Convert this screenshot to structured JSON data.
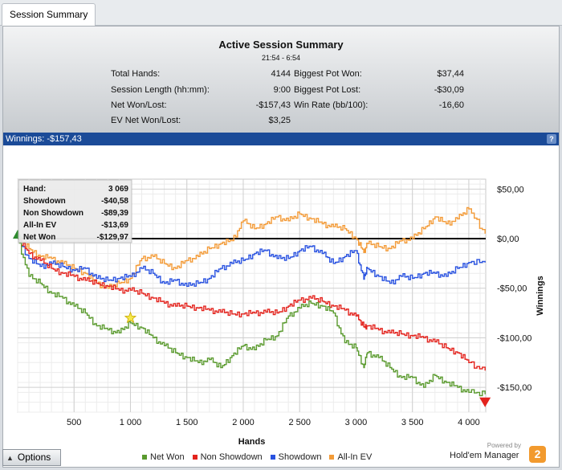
{
  "tab": {
    "label": "Session Summary"
  },
  "summary": {
    "title": "Active Session Summary",
    "time": "21:54 - 6:54",
    "left": [
      {
        "label": "Total Hands:",
        "value": "4144"
      },
      {
        "label": "Session Length (hh:mm):",
        "value": "9:00"
      },
      {
        "label": "Net Won/Lost:",
        "value": "-$157,43"
      },
      {
        "label": "EV Net Won/Lost:",
        "value": "$3,25"
      }
    ],
    "right": [
      {
        "label": "Biggest Pot Won:",
        "value": "$37,44"
      },
      {
        "label": "Biggest Pot Lost:",
        "value": "-$30,09"
      },
      {
        "label": "Win Rate (bb/100):",
        "value": "-16,60"
      }
    ]
  },
  "winnings_bar": {
    "label": "Winnings: -$157,43",
    "help": "?"
  },
  "tooltip": {
    "rows": [
      {
        "label": "Hand:",
        "value": "3 069"
      },
      {
        "label": "Showdown",
        "value": "-$40,58"
      },
      {
        "label": "Non Showdown",
        "value": "-$89,39"
      },
      {
        "label": "All-In EV",
        "value": "-$13,69"
      },
      {
        "label": "Net Won",
        "value": "-$129,97"
      }
    ]
  },
  "chart_data": {
    "type": "line",
    "xlabel": "Hands",
    "ylabel": "Winnings",
    "xlim": [
      0,
      4150
    ],
    "ylim": [
      -175,
      60
    ],
    "x_ticks": [
      500,
      1000,
      1500,
      2000,
      2500,
      3000,
      3500,
      4000
    ],
    "x_tick_labels": [
      "500",
      "1 000",
      "1 500",
      "2 000",
      "2 500",
      "3 000",
      "3 500",
      "4 000"
    ],
    "y_ticks": [
      50,
      0,
      -50,
      -100,
      -150
    ],
    "y_tick_labels": [
      "$50,00",
      "$0,00",
      "-$50,00",
      "-$100,00",
      "-$150,00"
    ],
    "grid": true,
    "legend_position": "bottom",
    "series": [
      {
        "name": "Net Won",
        "color": "#5a9a2e",
        "x": [
          0,
          100,
          200,
          300,
          400,
          500,
          600,
          700,
          800,
          900,
          1000,
          1100,
          1200,
          1300,
          1400,
          1500,
          1600,
          1700,
          1800,
          1900,
          2000,
          2100,
          2200,
          2300,
          2400,
          2500,
          2600,
          2700,
          2800,
          2900,
          3000,
          3069,
          3100,
          3200,
          3300,
          3400,
          3500,
          3600,
          3700,
          3800,
          3900,
          4000,
          4144
        ],
        "y": [
          0,
          -38,
          -45,
          -55,
          -60,
          -68,
          -75,
          -88,
          -92,
          -95,
          -85,
          -90,
          -100,
          -108,
          -115,
          -120,
          -125,
          -122,
          -130,
          -118,
          -108,
          -112,
          -102,
          -98,
          -78,
          -70,
          -65,
          -68,
          -75,
          -105,
          -110,
          -130,
          -115,
          -120,
          -130,
          -140,
          -140,
          -150,
          -138,
          -145,
          -150,
          -155,
          -157
        ]
      },
      {
        "name": "Non Showdown",
        "color": "#e3231d",
        "x": [
          0,
          100,
          200,
          300,
          400,
          500,
          600,
          700,
          800,
          900,
          1000,
          1100,
          1200,
          1300,
          1400,
          1500,
          1600,
          1700,
          1800,
          1900,
          2000,
          2100,
          2200,
          2300,
          2400,
          2500,
          2600,
          2700,
          2800,
          2900,
          3000,
          3069,
          3100,
          3200,
          3300,
          3400,
          3500,
          3600,
          3700,
          3800,
          3900,
          4000,
          4144
        ],
        "y": [
          0,
          -15,
          -22,
          -30,
          -35,
          -38,
          -42,
          -45,
          -48,
          -52,
          -52,
          -55,
          -60,
          -65,
          -68,
          -68,
          -70,
          -72,
          -74,
          -76,
          -76,
          -75,
          -74,
          -75,
          -68,
          -62,
          -60,
          -63,
          -68,
          -72,
          -78,
          -89,
          -88,
          -92,
          -95,
          -96,
          -98,
          -100,
          -104,
          -110,
          -115,
          -125,
          -133
        ]
      },
      {
        "name": "Showdown",
        "color": "#2952e0",
        "x": [
          0,
          100,
          200,
          300,
          400,
          500,
          600,
          700,
          800,
          900,
          1000,
          1100,
          1200,
          1300,
          1400,
          1500,
          1600,
          1700,
          1800,
          1900,
          2000,
          2100,
          2200,
          2300,
          2400,
          2500,
          2600,
          2700,
          2800,
          2900,
          3000,
          3069,
          3100,
          3200,
          3300,
          3400,
          3500,
          3600,
          3700,
          3800,
          3900,
          4000,
          4144
        ],
        "y": [
          0,
          -20,
          -28,
          -25,
          -28,
          -32,
          -30,
          -40,
          -42,
          -40,
          -38,
          -30,
          -35,
          -45,
          -42,
          -48,
          -45,
          -40,
          -30,
          -25,
          -22,
          -15,
          -12,
          -20,
          -20,
          -12,
          -8,
          -15,
          -25,
          -18,
          -12,
          -41,
          -30,
          -38,
          -45,
          -38,
          -40,
          -35,
          -35,
          -38,
          -30,
          -24,
          -24
        ]
      },
      {
        "name": "All-In EV",
        "color": "#f39b38",
        "x": [
          0,
          100,
          200,
          300,
          400,
          500,
          600,
          700,
          800,
          900,
          1000,
          1100,
          1200,
          1300,
          1400,
          1500,
          1600,
          1700,
          1800,
          1900,
          2000,
          2100,
          2200,
          2300,
          2400,
          2500,
          2600,
          2700,
          2800,
          2900,
          3000,
          3069,
          3100,
          3200,
          3300,
          3400,
          3500,
          3600,
          3700,
          3800,
          3900,
          4000,
          4144
        ],
        "y": [
          0,
          -10,
          -18,
          -20,
          -25,
          -30,
          -35,
          -45,
          -50,
          -45,
          -40,
          -20,
          -18,
          -25,
          -30,
          -22,
          -18,
          -10,
          -5,
          -2,
          18,
          10,
          15,
          22,
          18,
          25,
          20,
          15,
          12,
          10,
          0,
          -14,
          -5,
          -8,
          -10,
          -2,
          0,
          10,
          22,
          15,
          20,
          30,
          5
        ]
      }
    ]
  },
  "options_button": {
    "label": "Options"
  },
  "legend": [
    {
      "name": "Net Won",
      "color": "#5a9a2e"
    },
    {
      "name": "Non Showdown",
      "color": "#e3231d"
    },
    {
      "name": "Showdown",
      "color": "#2952e0"
    },
    {
      "name": "All-In EV",
      "color": "#f39b38"
    }
  ],
  "brand": {
    "powered": "Powered by",
    "name": "Hold'em Manager",
    "logo": "2"
  }
}
